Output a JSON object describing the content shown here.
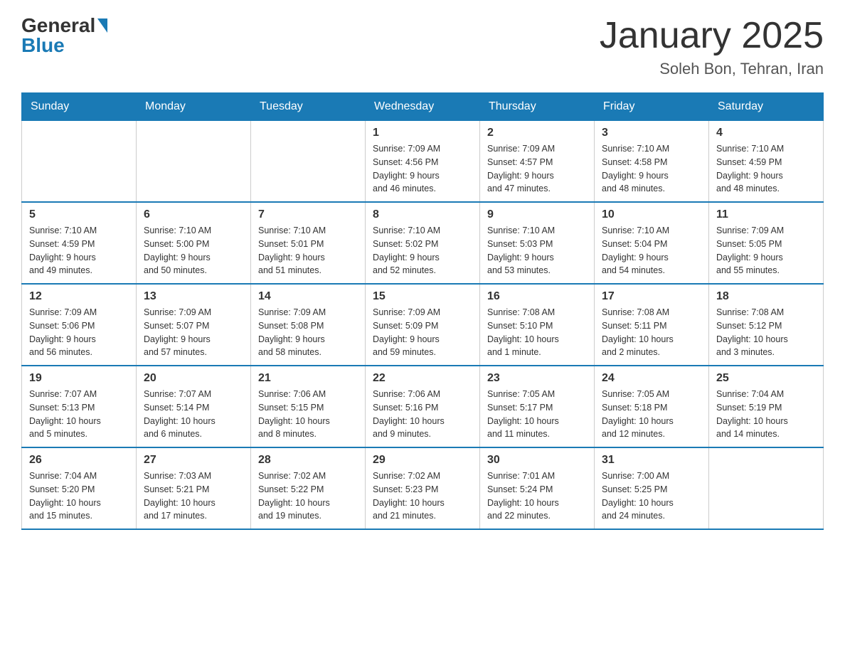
{
  "header": {
    "logo_general": "General",
    "logo_blue": "Blue",
    "month_title": "January 2025",
    "subtitle": "Soleh Bon, Tehran, Iran"
  },
  "weekdays": [
    "Sunday",
    "Monday",
    "Tuesday",
    "Wednesday",
    "Thursday",
    "Friday",
    "Saturday"
  ],
  "weeks": [
    [
      {
        "day": "",
        "info": ""
      },
      {
        "day": "",
        "info": ""
      },
      {
        "day": "",
        "info": ""
      },
      {
        "day": "1",
        "info": "Sunrise: 7:09 AM\nSunset: 4:56 PM\nDaylight: 9 hours\nand 46 minutes."
      },
      {
        "day": "2",
        "info": "Sunrise: 7:09 AM\nSunset: 4:57 PM\nDaylight: 9 hours\nand 47 minutes."
      },
      {
        "day": "3",
        "info": "Sunrise: 7:10 AM\nSunset: 4:58 PM\nDaylight: 9 hours\nand 48 minutes."
      },
      {
        "day": "4",
        "info": "Sunrise: 7:10 AM\nSunset: 4:59 PM\nDaylight: 9 hours\nand 48 minutes."
      }
    ],
    [
      {
        "day": "5",
        "info": "Sunrise: 7:10 AM\nSunset: 4:59 PM\nDaylight: 9 hours\nand 49 minutes."
      },
      {
        "day": "6",
        "info": "Sunrise: 7:10 AM\nSunset: 5:00 PM\nDaylight: 9 hours\nand 50 minutes."
      },
      {
        "day": "7",
        "info": "Sunrise: 7:10 AM\nSunset: 5:01 PM\nDaylight: 9 hours\nand 51 minutes."
      },
      {
        "day": "8",
        "info": "Sunrise: 7:10 AM\nSunset: 5:02 PM\nDaylight: 9 hours\nand 52 minutes."
      },
      {
        "day": "9",
        "info": "Sunrise: 7:10 AM\nSunset: 5:03 PM\nDaylight: 9 hours\nand 53 minutes."
      },
      {
        "day": "10",
        "info": "Sunrise: 7:10 AM\nSunset: 5:04 PM\nDaylight: 9 hours\nand 54 minutes."
      },
      {
        "day": "11",
        "info": "Sunrise: 7:09 AM\nSunset: 5:05 PM\nDaylight: 9 hours\nand 55 minutes."
      }
    ],
    [
      {
        "day": "12",
        "info": "Sunrise: 7:09 AM\nSunset: 5:06 PM\nDaylight: 9 hours\nand 56 minutes."
      },
      {
        "day": "13",
        "info": "Sunrise: 7:09 AM\nSunset: 5:07 PM\nDaylight: 9 hours\nand 57 minutes."
      },
      {
        "day": "14",
        "info": "Sunrise: 7:09 AM\nSunset: 5:08 PM\nDaylight: 9 hours\nand 58 minutes."
      },
      {
        "day": "15",
        "info": "Sunrise: 7:09 AM\nSunset: 5:09 PM\nDaylight: 9 hours\nand 59 minutes."
      },
      {
        "day": "16",
        "info": "Sunrise: 7:08 AM\nSunset: 5:10 PM\nDaylight: 10 hours\nand 1 minute."
      },
      {
        "day": "17",
        "info": "Sunrise: 7:08 AM\nSunset: 5:11 PM\nDaylight: 10 hours\nand 2 minutes."
      },
      {
        "day": "18",
        "info": "Sunrise: 7:08 AM\nSunset: 5:12 PM\nDaylight: 10 hours\nand 3 minutes."
      }
    ],
    [
      {
        "day": "19",
        "info": "Sunrise: 7:07 AM\nSunset: 5:13 PM\nDaylight: 10 hours\nand 5 minutes."
      },
      {
        "day": "20",
        "info": "Sunrise: 7:07 AM\nSunset: 5:14 PM\nDaylight: 10 hours\nand 6 minutes."
      },
      {
        "day": "21",
        "info": "Sunrise: 7:06 AM\nSunset: 5:15 PM\nDaylight: 10 hours\nand 8 minutes."
      },
      {
        "day": "22",
        "info": "Sunrise: 7:06 AM\nSunset: 5:16 PM\nDaylight: 10 hours\nand 9 minutes."
      },
      {
        "day": "23",
        "info": "Sunrise: 7:05 AM\nSunset: 5:17 PM\nDaylight: 10 hours\nand 11 minutes."
      },
      {
        "day": "24",
        "info": "Sunrise: 7:05 AM\nSunset: 5:18 PM\nDaylight: 10 hours\nand 12 minutes."
      },
      {
        "day": "25",
        "info": "Sunrise: 7:04 AM\nSunset: 5:19 PM\nDaylight: 10 hours\nand 14 minutes."
      }
    ],
    [
      {
        "day": "26",
        "info": "Sunrise: 7:04 AM\nSunset: 5:20 PM\nDaylight: 10 hours\nand 15 minutes."
      },
      {
        "day": "27",
        "info": "Sunrise: 7:03 AM\nSunset: 5:21 PM\nDaylight: 10 hours\nand 17 minutes."
      },
      {
        "day": "28",
        "info": "Sunrise: 7:02 AM\nSunset: 5:22 PM\nDaylight: 10 hours\nand 19 minutes."
      },
      {
        "day": "29",
        "info": "Sunrise: 7:02 AM\nSunset: 5:23 PM\nDaylight: 10 hours\nand 21 minutes."
      },
      {
        "day": "30",
        "info": "Sunrise: 7:01 AM\nSunset: 5:24 PM\nDaylight: 10 hours\nand 22 minutes."
      },
      {
        "day": "31",
        "info": "Sunrise: 7:00 AM\nSunset: 5:25 PM\nDaylight: 10 hours\nand 24 minutes."
      },
      {
        "day": "",
        "info": ""
      }
    ]
  ]
}
